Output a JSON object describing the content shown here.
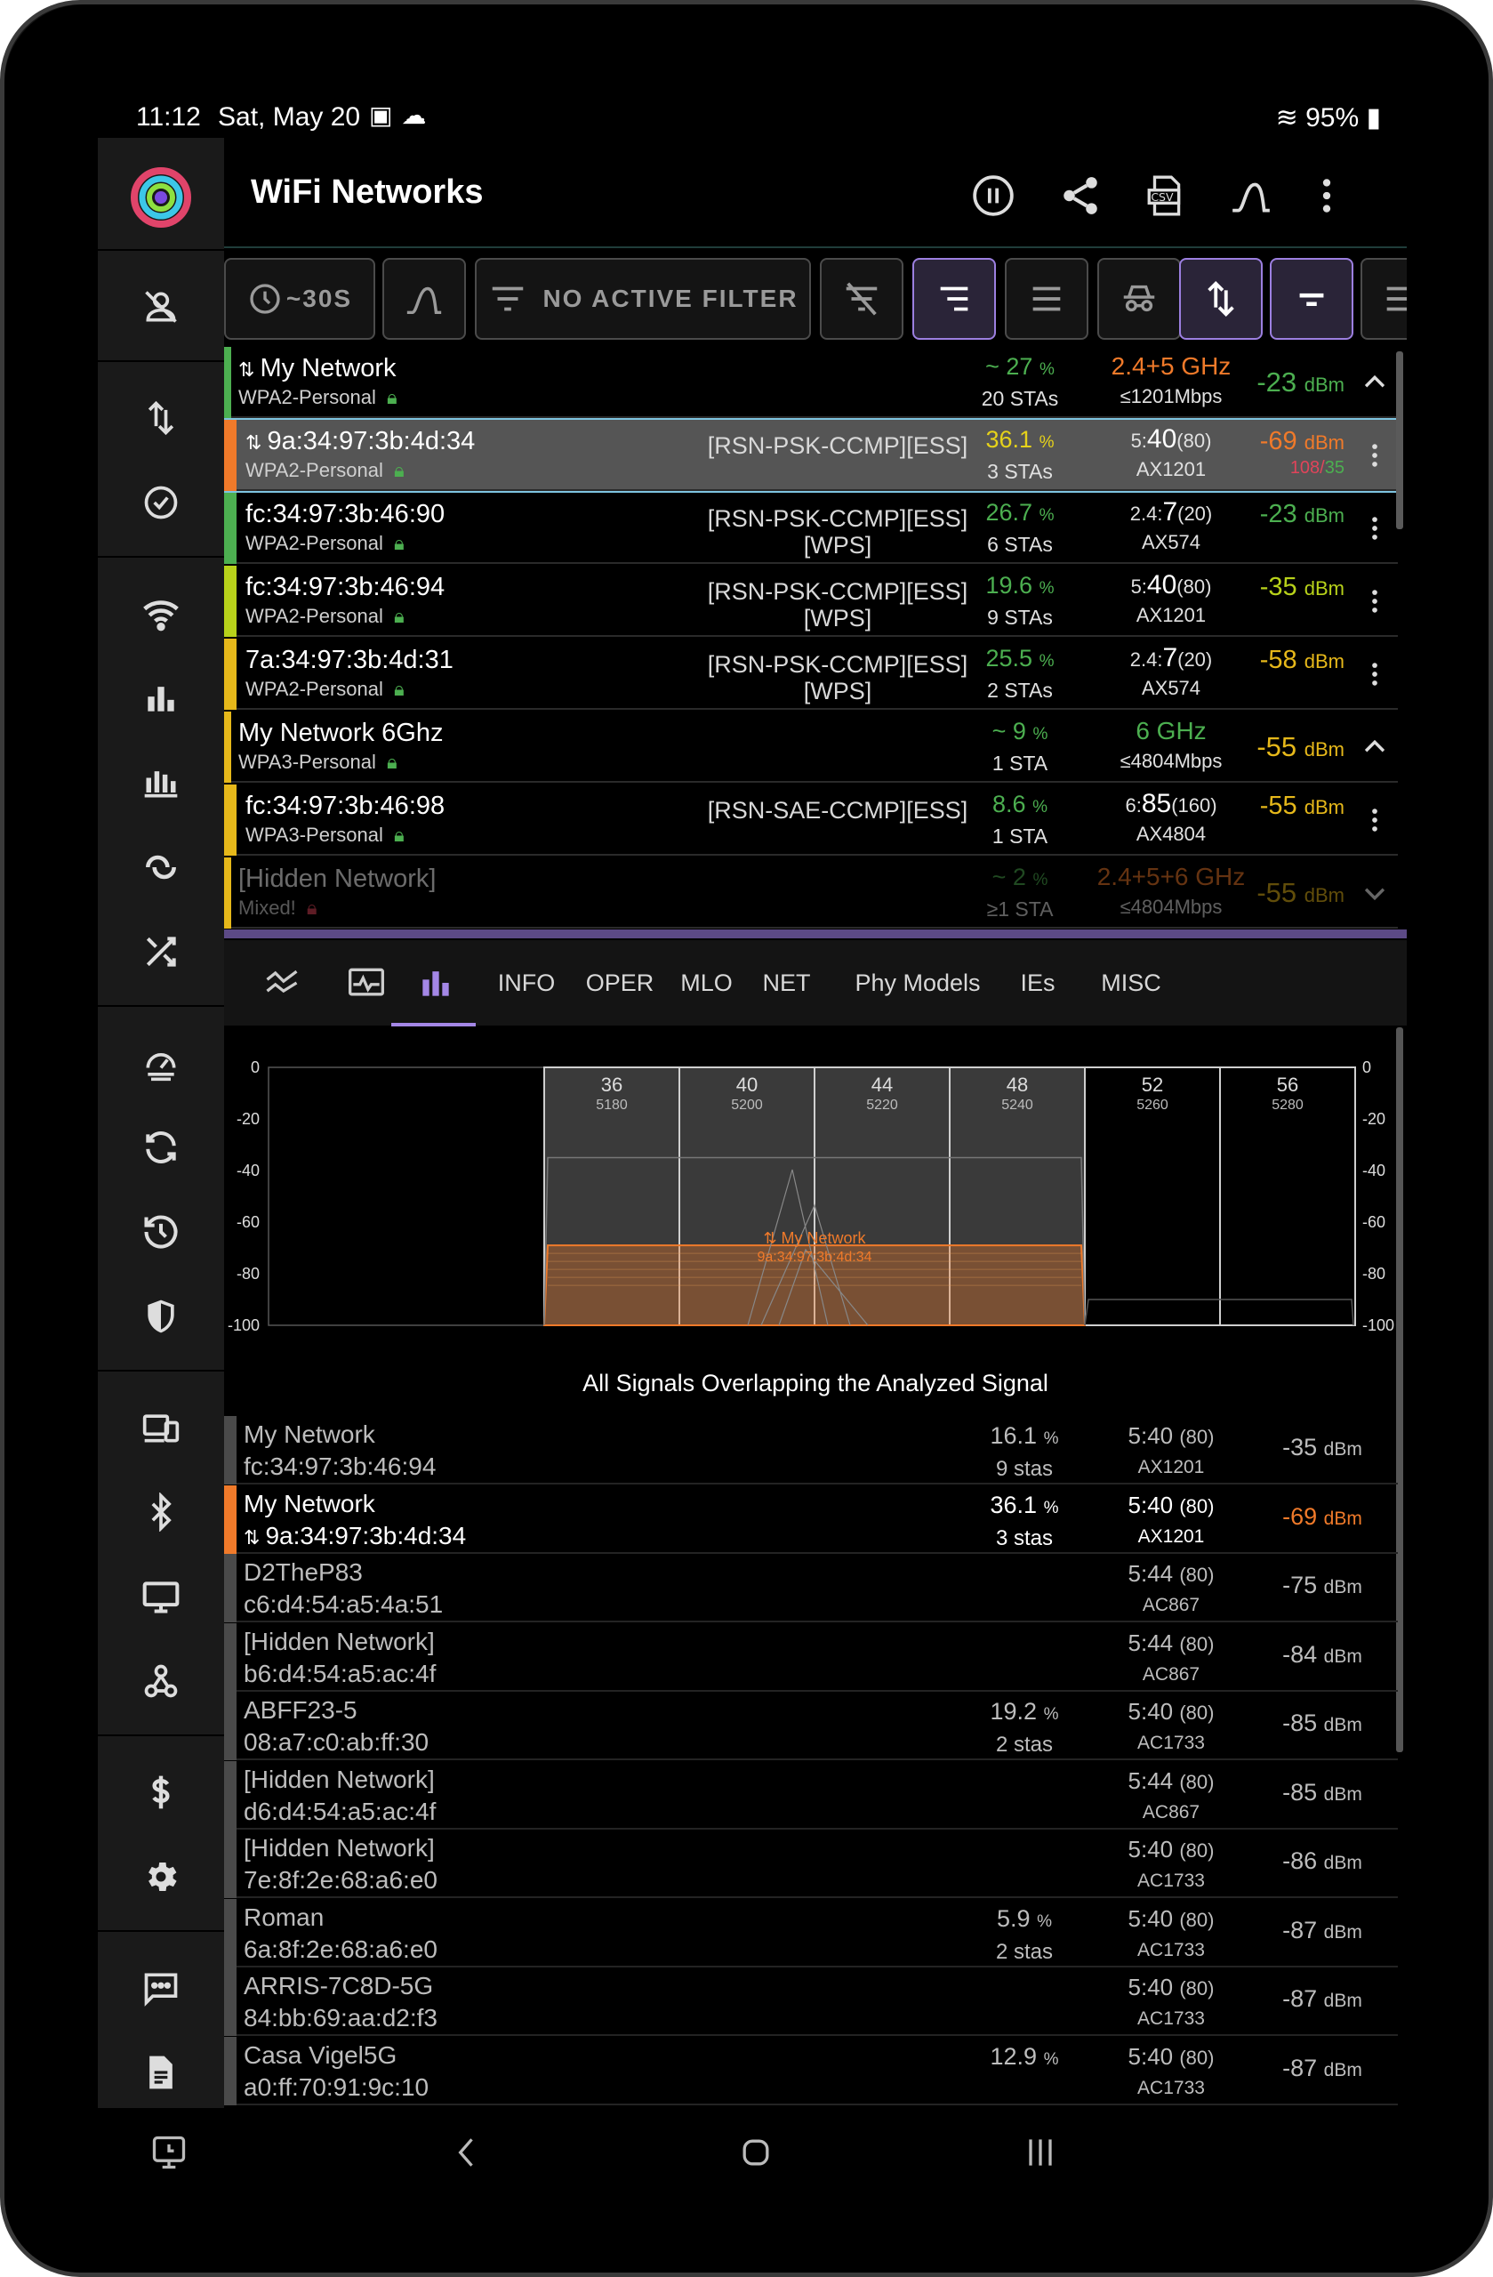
{
  "status_bar": {
    "time": "11:12",
    "date": "Sat, May 20",
    "battery": "95%"
  },
  "app": {
    "title": "WiFi Networks"
  },
  "toolbar": {
    "interval_label": "~30S",
    "filter_label": "NO ACTIVE FILTER"
  },
  "colors": {
    "accent": "#a487e6",
    "green": "#4caf50",
    "yellow": "#e6d21a",
    "orange": "#f07a2a",
    "red": "#e0445a",
    "highlight_border": "#7ec4e0"
  },
  "networks": [
    {
      "name": "My Network",
      "security": "WPA2-Personal",
      "caps": "",
      "caps2": "",
      "util": "~ 27",
      "util_unit": "%",
      "stas": "20 STAs",
      "band": "2.4+5 GHz",
      "channel_prefix": "",
      "channel": "",
      "width": "",
      "rate": "≤1201Mbps",
      "rssi": "-23",
      "rssi_unit": "dBm",
      "rssi_sub": "",
      "rssi_sub2": "",
      "group": true,
      "color": "#4caf50"
    },
    {
      "name": "9a:34:97:3b:4d:34",
      "security": "WPA2-Personal",
      "caps": "[RSN-PSK-CCMP][ESS]",
      "caps2": "",
      "util": "36.1",
      "util_unit": "%",
      "stas": "3 STAs",
      "band": "",
      "channel_prefix": "5:",
      "channel": "40",
      "width": "(80)",
      "rate": "AX1201",
      "rssi": "-69",
      "rssi_unit": "dBm",
      "rssi_sub": "108/",
      "rssi_sub2": "35",
      "group": false,
      "color": "#f07a2a",
      "selected": true
    },
    {
      "name": "fc:34:97:3b:46:90",
      "security": "WPA2-Personal",
      "caps": "[RSN-PSK-CCMP][ESS]",
      "caps2": "[WPS]",
      "util": "26.7",
      "util_unit": "%",
      "stas": "6 STAs",
      "band": "",
      "channel_prefix": "2.4:",
      "channel": "7",
      "width": "(20)",
      "rate": "AX574",
      "rssi": "-23",
      "rssi_unit": "dBm",
      "rssi_sub": "",
      "rssi_sub2": "",
      "group": false,
      "color": "#4caf50"
    },
    {
      "name": "fc:34:97:3b:46:94",
      "security": "WPA2-Personal",
      "caps": "[RSN-PSK-CCMP][ESS]",
      "caps2": "[WPS]",
      "util": "19.6",
      "util_unit": "%",
      "stas": "9 STAs",
      "band": "",
      "channel_prefix": "5:",
      "channel": "40",
      "width": "(80)",
      "rate": "AX1201",
      "rssi": "-35",
      "rssi_unit": "dBm",
      "rssi_sub": "",
      "rssi_sub2": "",
      "group": false,
      "color": "#b8d21a"
    },
    {
      "name": "7a:34:97:3b:4d:31",
      "security": "WPA2-Personal",
      "caps": "[RSN-PSK-CCMP][ESS]",
      "caps2": "[WPS]",
      "util": "25.5",
      "util_unit": "%",
      "stas": "2 STAs",
      "band": "",
      "channel_prefix": "2.4:",
      "channel": "7",
      "width": "(20)",
      "rate": "AX574",
      "rssi": "-58",
      "rssi_unit": "dBm",
      "rssi_sub": "",
      "rssi_sub2": "",
      "group": false,
      "color": "#e6b81a"
    },
    {
      "name": "My Network 6Ghz",
      "security": "WPA3-Personal",
      "caps": "",
      "caps2": "",
      "util": "~ 9",
      "util_unit": "%",
      "stas": "1 STA",
      "band": "6 GHz",
      "channel_prefix": "",
      "channel": "",
      "width": "",
      "rate": "≤4804Mbps",
      "rssi": "-55",
      "rssi_unit": "dBm",
      "rssi_sub": "",
      "rssi_sub2": "",
      "group": true,
      "color": "#e6b81a"
    },
    {
      "name": "fc:34:97:3b:46:98",
      "security": "WPA3-Personal",
      "caps": "[RSN-SAE-CCMP][ESS]",
      "caps2": "",
      "util": "8.6",
      "util_unit": "%",
      "stas": "1 STA",
      "band": "",
      "channel_prefix": "6:",
      "channel": "85",
      "width": "(160)",
      "rate": "AX4804",
      "rssi": "-55",
      "rssi_unit": "dBm",
      "rssi_sub": "",
      "rssi_sub2": "",
      "group": false,
      "color": "#e6b81a"
    },
    {
      "name": "[Hidden Network]",
      "security": "Mixed!",
      "caps": "",
      "caps2": "",
      "util": "~ 2",
      "util_unit": "%",
      "stas": "≥1 STA",
      "band": "2.4+5+6 GHz",
      "channel_prefix": "",
      "channel": "",
      "width": "",
      "rate": "≤4804Mbps",
      "rssi": "-55",
      "rssi_unit": "dBm",
      "rssi_sub": "",
      "rssi_sub2": "",
      "group": true,
      "color": "#e6b81a",
      "dim": true
    }
  ],
  "tabs": [
    "INFO",
    "OPER",
    "MLO",
    "NET",
    "Phy Models",
    "IEs",
    "MISC"
  ],
  "chart_data": {
    "type": "bar",
    "title": "",
    "channels": [
      "36",
      "40",
      "44",
      "48",
      "52",
      "56"
    ],
    "frequencies": [
      "5180",
      "5200",
      "5220",
      "5240",
      "5260",
      "5280"
    ],
    "y_ticks": [
      "0",
      "-20",
      "-40",
      "-60",
      "-80",
      "-100"
    ],
    "ylim": [
      -100,
      0
    ],
    "series": [
      {
        "name": "9a:34:97:3b:4d:34",
        "label": "My Network",
        "start_channel": 36,
        "end_channel": 48,
        "rssi": -69,
        "color": "#f07a2a"
      },
      {
        "name": "fc:34:97:3b:46:94",
        "label": "",
        "start_channel": 36,
        "end_channel": 48,
        "rssi": -35,
        "color": "#777777"
      },
      {
        "name": "background",
        "label": "",
        "start_channel": 52,
        "end_channel": 64,
        "rssi": -90,
        "color": "#555555"
      }
    ]
  },
  "overlap": {
    "title": "All Signals Overlapping the Analyzed Signal",
    "rows": [
      {
        "ssid": "My Network",
        "bssid": "fc:34:97:3b:46:94",
        "util": "16.1",
        "util_unit": "%",
        "stas": "9 stas",
        "ch": "5:40",
        "width": "(80)",
        "rate": "AX1201",
        "rssi": "-35",
        "rssi_unit": "dBm",
        "highlight": false
      },
      {
        "ssid": "My Network",
        "bssid": "9a:34:97:3b:4d:34",
        "util": "36.1",
        "util_unit": "%",
        "stas": "3 stas",
        "ch": "5:40",
        "width": "(80)",
        "rate": "AX1201",
        "rssi": "-69",
        "rssi_unit": "dBm",
        "highlight": true
      },
      {
        "ssid": "D2TheP83",
        "bssid": "c6:d4:54:a5:4a:51",
        "util": "",
        "util_unit": "",
        "stas": "",
        "ch": "5:44",
        "width": "(80)",
        "rate": "AC867",
        "rssi": "-75",
        "rssi_unit": "dBm",
        "highlight": false
      },
      {
        "ssid": "[Hidden Network]",
        "bssid": "b6:d4:54:a5:ac:4f",
        "util": "",
        "util_unit": "",
        "stas": "",
        "ch": "5:44",
        "width": "(80)",
        "rate": "AC867",
        "rssi": "-84",
        "rssi_unit": "dBm",
        "highlight": false
      },
      {
        "ssid": "ABFF23-5",
        "bssid": "08:a7:c0:ab:ff:30",
        "util": "19.2",
        "util_unit": "%",
        "stas": "2 stas",
        "ch": "5:40",
        "width": "(80)",
        "rate": "AC1733",
        "rssi": "-85",
        "rssi_unit": "dBm",
        "highlight": false
      },
      {
        "ssid": "[Hidden Network]",
        "bssid": "d6:d4:54:a5:ac:4f",
        "util": "",
        "util_unit": "",
        "stas": "",
        "ch": "5:44",
        "width": "(80)",
        "rate": "AC867",
        "rssi": "-85",
        "rssi_unit": "dBm",
        "highlight": false
      },
      {
        "ssid": "[Hidden Network]",
        "bssid": "7e:8f:2e:68:a6:e0",
        "util": "",
        "util_unit": "",
        "stas": "",
        "ch": "5:40",
        "width": "(80)",
        "rate": "AC1733",
        "rssi": "-86",
        "rssi_unit": "dBm",
        "highlight": false
      },
      {
        "ssid": "Roman",
        "bssid": "6a:8f:2e:68:a6:e0",
        "util": "5.9",
        "util_unit": "%",
        "stas": "2 stas",
        "ch": "5:40",
        "width": "(80)",
        "rate": "AC1733",
        "rssi": "-87",
        "rssi_unit": "dBm",
        "highlight": false
      },
      {
        "ssid": "ARRIS-7C8D-5G",
        "bssid": "84:bb:69:aa:d2:f3",
        "util": "",
        "util_unit": "",
        "stas": "",
        "ch": "5:40",
        "width": "(80)",
        "rate": "AC1733",
        "rssi": "-87",
        "rssi_unit": "dBm",
        "highlight": false
      },
      {
        "ssid": "Casa Vigel5G",
        "bssid": "a0:ff:70:91:9c:10",
        "util": "12.9",
        "util_unit": "%",
        "stas": "",
        "ch": "5:40",
        "width": "(80)",
        "rate": "AC1733",
        "rssi": "-87",
        "rssi_unit": "dBm",
        "highlight": false
      }
    ]
  },
  "icons": {
    "rail": [
      "person-off-icon",
      "swap-vert-icon",
      "check-circle-icon",
      "wifi-icon",
      "bar-chart-icon",
      "stacked-bars-icon",
      "link-icon",
      "shuffle-icon",
      "speed-icon",
      "sync-icon",
      "history-icon",
      "shield-icon",
      "devices-icon",
      "bluetooth-icon",
      "monitor-icon",
      "webhook-icon",
      "dollar-icon",
      "gear-icon",
      "chat-icon",
      "document-icon"
    ],
    "appbar": [
      "pause-icon",
      "share-icon",
      "csv-icon",
      "curve-icon",
      "more-vert-icon"
    ]
  }
}
